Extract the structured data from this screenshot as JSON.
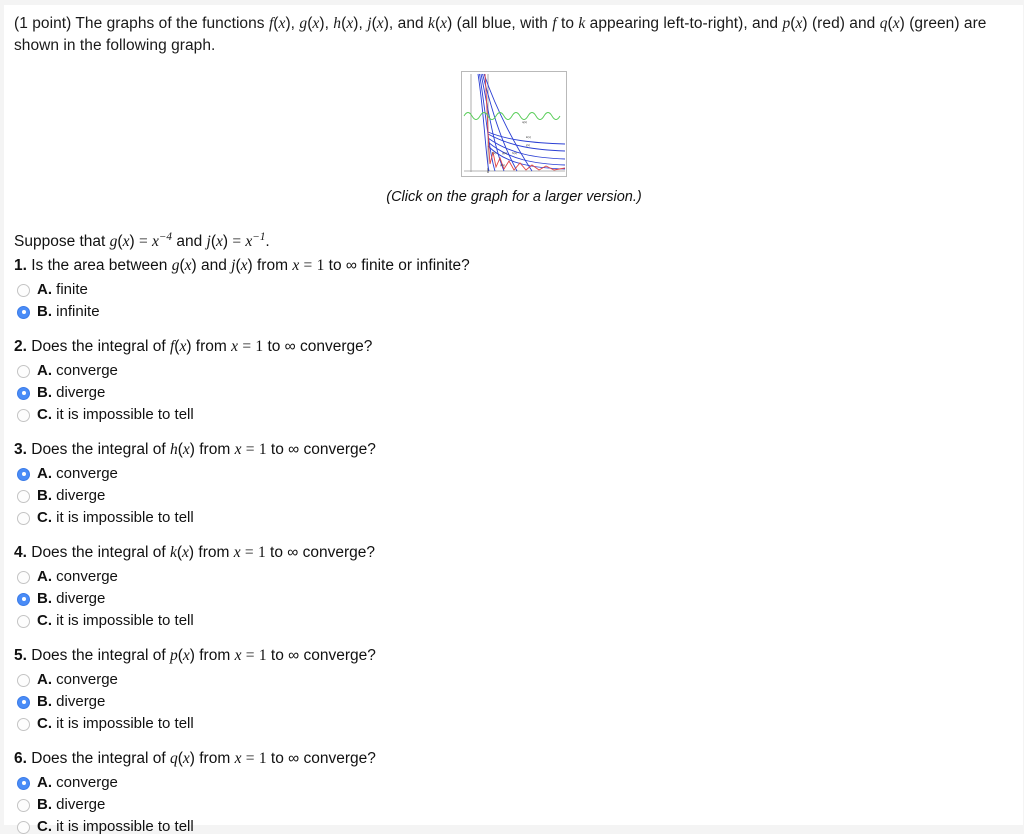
{
  "problem": {
    "points_label": "(1 point)",
    "intro_text": "(1 point) The graphs of the functions f(x), g(x), h(x), j(x), and k(x) (all blue, with f to k appearing left-to-right), and p(x) (red) and q(x) (green) are shown in the following graph.",
    "graph_caption": "(Click on the graph for a larger version.)",
    "suppose_text": "Suppose that g(x) = x⁻⁴ and j(x) = x⁻¹ .",
    "colors": {
      "blue_curves": "#2b3fd4",
      "red_curve": "#e04444",
      "green_curve": "#55cc55",
      "radio_selected": "#4a8cf7",
      "radio_border": "#c4c4c4",
      "text": "#111111"
    }
  },
  "graph": {
    "series": [
      {
        "name": "f(x)",
        "color": "blue",
        "label": "f(x)"
      },
      {
        "name": "g(x)",
        "color": "blue",
        "label": "g(x)"
      },
      {
        "name": "h(x)",
        "color": "blue",
        "label": "h(x)"
      },
      {
        "name": "j(x)",
        "color": "blue",
        "label": "j(x)"
      },
      {
        "name": "k(x)",
        "color": "blue",
        "label": "k(x)"
      },
      {
        "name": "p(x)",
        "color": "red",
        "label": "p(x)"
      },
      {
        "name": "q(x)",
        "color": "green",
        "label": "q(x)"
      }
    ]
  },
  "questions": [
    {
      "number": "1.",
      "prefix": "Is the area between ",
      "fn1": "g(x)",
      "mid": " and ",
      "fn2": "j(x)",
      "suffix": " from x = 1 to ∞ finite or infinite?",
      "full_text": "1. Is the area between g(x) and j(x) from x = 1 to ∞ finite or infinite?",
      "choices": [
        {
          "letter": "A.",
          "text": "finite",
          "selected": false
        },
        {
          "letter": "B.",
          "text": "infinite",
          "selected": true
        }
      ]
    },
    {
      "number": "2.",
      "prefix": "Does the integral of ",
      "fn1": "f(x)",
      "suffix": " from x = 1 to ∞ converge?",
      "full_text": "2. Does the integral of f(x) from x = 1 to ∞ converge?",
      "choices": [
        {
          "letter": "A.",
          "text": "converge",
          "selected": false
        },
        {
          "letter": "B.",
          "text": "diverge",
          "selected": true
        },
        {
          "letter": "C.",
          "text": "it is impossible to tell",
          "selected": false
        }
      ]
    },
    {
      "number": "3.",
      "prefix": "Does the integral of ",
      "fn1": "h(x)",
      "suffix": " from x = 1 to ∞ converge?",
      "full_text": "3. Does the integral of h(x) from x = 1 to ∞ converge?",
      "choices": [
        {
          "letter": "A.",
          "text": "converge",
          "selected": true
        },
        {
          "letter": "B.",
          "text": "diverge",
          "selected": false
        },
        {
          "letter": "C.",
          "text": "it is impossible to tell",
          "selected": false
        }
      ]
    },
    {
      "number": "4.",
      "prefix": "Does the integral of ",
      "fn1": "k(x)",
      "suffix": " from x = 1 to ∞ converge?",
      "full_text": "4. Does the integral of k(x) from x = 1 to ∞ converge?",
      "choices": [
        {
          "letter": "A.",
          "text": "converge",
          "selected": false
        },
        {
          "letter": "B.",
          "text": "diverge",
          "selected": true
        },
        {
          "letter": "C.",
          "text": "it is impossible to tell",
          "selected": false
        }
      ]
    },
    {
      "number": "5.",
      "prefix": "Does the integral of ",
      "fn1": "p(x)",
      "suffix": " from x = 1 to ∞ converge?",
      "full_text": "5. Does the integral of p(x) from x = 1 to ∞ converge?",
      "choices": [
        {
          "letter": "A.",
          "text": "converge",
          "selected": false
        },
        {
          "letter": "B.",
          "text": "diverge",
          "selected": true
        },
        {
          "letter": "C.",
          "text": "it is impossible to tell",
          "selected": false
        }
      ]
    },
    {
      "number": "6.",
      "prefix": "Does the integral of ",
      "fn1": "q(x)",
      "suffix": " from x = 1 to ∞ converge?",
      "full_text": "6. Does the integral of q(x) from x = 1 to ∞ converge?",
      "choices": [
        {
          "letter": "A.",
          "text": "converge",
          "selected": true
        },
        {
          "letter": "B.",
          "text": "diverge",
          "selected": false
        },
        {
          "letter": "C.",
          "text": "it is impossible to tell",
          "selected": false
        }
      ]
    }
  ]
}
